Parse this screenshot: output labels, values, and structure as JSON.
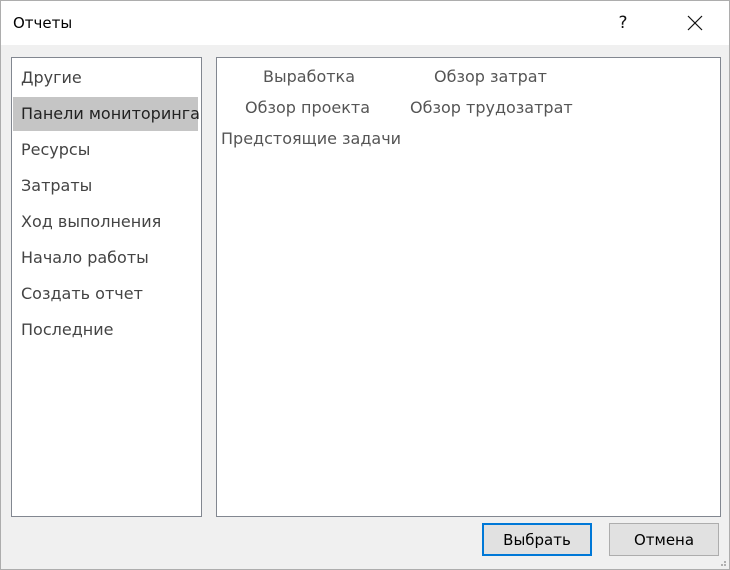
{
  "window": {
    "title": "Отчеты",
    "help_label": "?"
  },
  "categories": {
    "items": [
      {
        "label": "Другие"
      },
      {
        "label": "Панели мониторинга"
      },
      {
        "label": "Ресурсы"
      },
      {
        "label": "Затраты"
      },
      {
        "label": "Ход выполнения"
      },
      {
        "label": "Начало работы"
      },
      {
        "label": "Создать отчет"
      },
      {
        "label": "Последние"
      }
    ],
    "selected": "Панели мониторинга"
  },
  "reports": {
    "items": [
      {
        "label": "Выработка"
      },
      {
        "label": "Обзор затрат"
      },
      {
        "label": "Обзор проекта"
      },
      {
        "label": "Обзор трудозатрат"
      },
      {
        "label": "Предстоящие задачи"
      }
    ]
  },
  "footer": {
    "select_label": "Выбрать",
    "cancel_label": "Отмена"
  },
  "colors": {
    "selection": "#c5c5c5",
    "accent": "#0078d7",
    "background": "#f0f0f0"
  }
}
